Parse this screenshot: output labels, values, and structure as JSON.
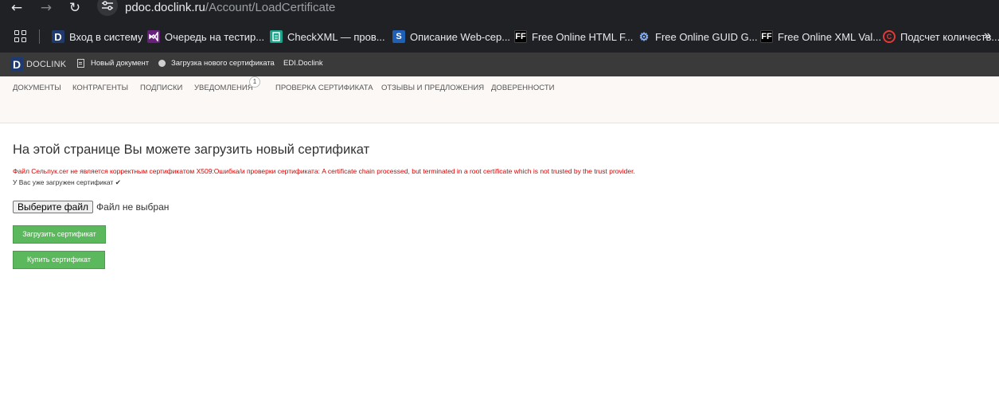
{
  "browser": {
    "url_domain": "pdoc.doclink.ru",
    "url_path": "/Account/LoadCertificate"
  },
  "bookmarks": [
    {
      "icon": "doclink-icon",
      "glyph": "D",
      "label": "Вход в систему"
    },
    {
      "icon": "visual-studio-icon",
      "glyph": "",
      "label": "Очередь на тестир..."
    },
    {
      "icon": "checkxml-icon",
      "glyph": "",
      "label": "CheckXML — пров..."
    },
    {
      "icon": "sharepoint-icon",
      "glyph": "S",
      "label": "Описание Web-сер..."
    },
    {
      "icon": "freeformatter-icon",
      "glyph": "FF",
      "label": "Free Online HTML F..."
    },
    {
      "icon": "gears-icon",
      "glyph": "",
      "label": "Free Online GUID G..."
    },
    {
      "icon": "freeformatter-icon",
      "glyph": "FF",
      "label": "Free Online XML Val..."
    },
    {
      "icon": "copyright-icon",
      "glyph": "C",
      "label": "Подсчет количеств..."
    }
  ],
  "appbar": {
    "logo_letter": "D",
    "logo_text": "DOCLINK",
    "new_document": "Новый документ",
    "load_certificate": "Загрузка нового сертификата",
    "edi": "EDI.Doclink"
  },
  "menu": {
    "items": [
      "ДОКУМЕНТЫ",
      "КОНТРАГЕНТЫ",
      "ПОДПИСКИ",
      "УВЕДОМЛЕНИЯ",
      "ПРОВЕРКА СЕРТИФИКАТА",
      "ОТЗЫВЫ И ПРЕДЛОЖЕНИЯ",
      "ДОВЕРЕННОСТИ"
    ],
    "notifications_badge": "1"
  },
  "content": {
    "title": "На этой странице Вы можете загрузить новый сертификат",
    "error": "Файл Сельпук.cer не является корректным сертификатом X509:Ошибка/и проверки сертификата: A certificate chain processed, but terminated in a root certificate which is not trusted by the trust provider.",
    "status": "У Вас уже загружен сертификат",
    "choose_file": "Выберите файл",
    "no_file": "Файл не выбран",
    "upload_button": "Загрузить сертификат",
    "buy_button": "Купить сертификат"
  },
  "colors": {
    "error": "#d90000",
    "button_green": "#5cb85c",
    "appbar": "#3a3a3a"
  }
}
